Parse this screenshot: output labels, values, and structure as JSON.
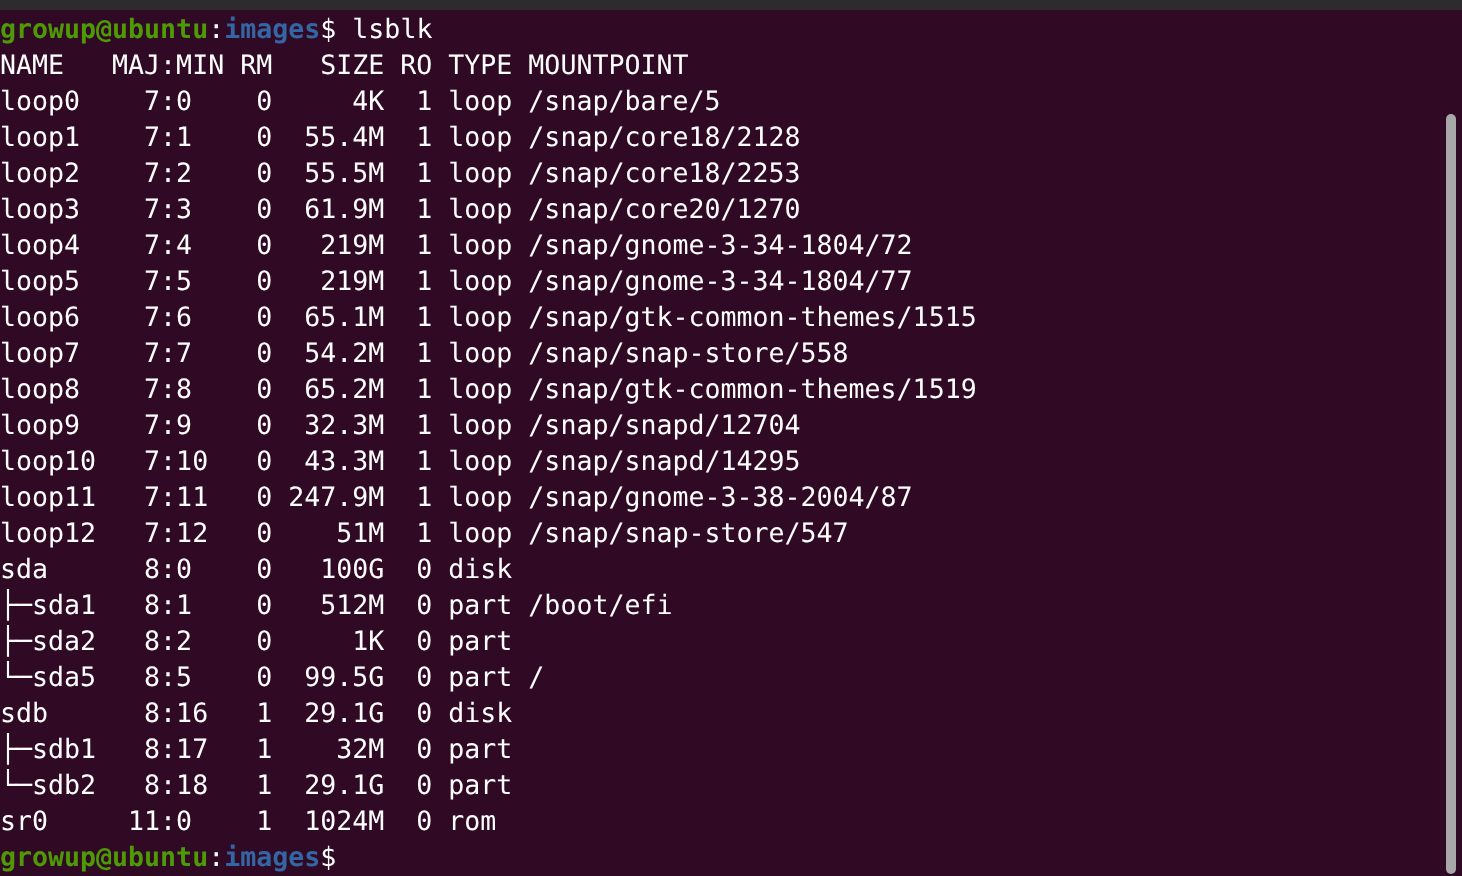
{
  "terminal": {
    "prompts": [
      {
        "user_host": "growup@ubuntu",
        "separator": ":",
        "path": "images",
        "symbol": "$",
        "command": "lsblk"
      }
    ],
    "output_lines": [
      "NAME   MAJ:MIN RM   SIZE RO TYPE MOUNTPOINT",
      "loop0    7:0    0     4K  1 loop /snap/bare/5",
      "loop1    7:1    0  55.4M  1 loop /snap/core18/2128",
      "loop2    7:2    0  55.5M  1 loop /snap/core18/2253",
      "loop3    7:3    0  61.9M  1 loop /snap/core20/1270",
      "loop4    7:4    0   219M  1 loop /snap/gnome-3-34-1804/72",
      "loop5    7:5    0   219M  1 loop /snap/gnome-3-34-1804/77",
      "loop6    7:6    0  65.1M  1 loop /snap/gtk-common-themes/1515",
      "loop7    7:7    0  54.2M  1 loop /snap/snap-store/558",
      "loop8    7:8    0  65.2M  1 loop /snap/gtk-common-themes/1519",
      "loop9    7:9    0  32.3M  1 loop /snap/snapd/12704",
      "loop10   7:10   0  43.3M  1 loop /snap/snapd/14295",
      "loop11   7:11   0 247.9M  1 loop /snap/gnome-3-38-2004/87",
      "loop12   7:12   0    51M  1 loop /snap/snap-store/547",
      "sda      8:0    0   100G  0 disk ",
      "├─sda1   8:1    0   512M  0 part /boot/efi",
      "├─sda2   8:2    0     1K  0 part ",
      "└─sda5   8:5    0  99.5G  0 part /",
      "sdb      8:16   1  29.1G  0 disk ",
      "├─sdb1   8:17   1    32M  0 part ",
      "└─sdb2   8:18   1  29.1G  0 part ",
      "sr0     11:0    1  1024M  0 rom  "
    ],
    "final_prompt": {
      "user_host": "growup@ubuntu",
      "separator": ":",
      "path": "images",
      "symbol": "$"
    }
  }
}
